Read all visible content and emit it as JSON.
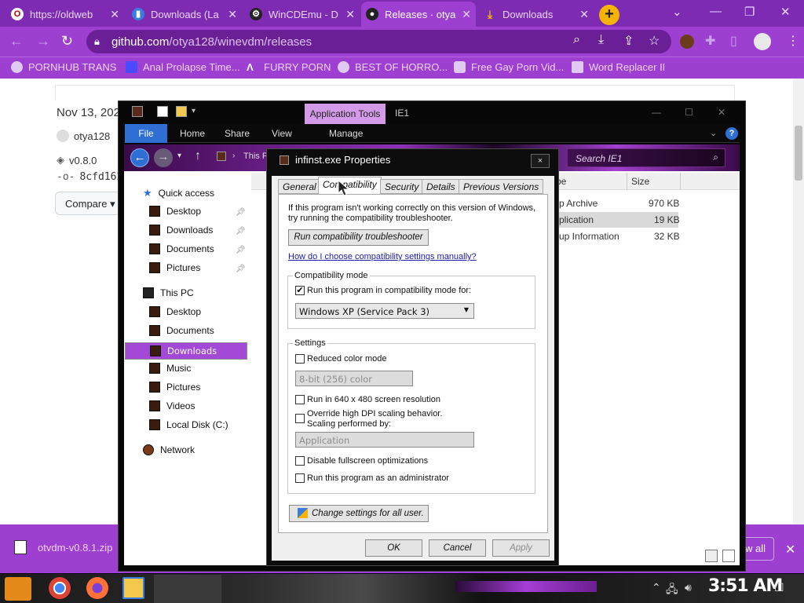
{
  "browser": {
    "tabs": [
      {
        "label": "https://oldweb",
        "icon": "opera-icon",
        "color": "#fff"
      },
      {
        "label": "Downloads (La",
        "icon": "doc-icon",
        "color": "#3b7ddd"
      },
      {
        "label": "WinCDEmu - D",
        "icon": "gear-icon",
        "color": "#222"
      },
      {
        "label": "Releases · otya",
        "icon": "github-icon",
        "color": "#222"
      },
      {
        "label": "Downloads",
        "icon": "download-icon",
        "color": "#f4b400"
      }
    ],
    "new_tab": "+",
    "url_domain": "github.com",
    "url_path": "/otya128/winevdm/releases",
    "bookmarks": [
      "PORNHUB TRANS",
      "Anal Prolapse Time...",
      "FURRY PORN",
      "BEST OF HORRO...",
      "Free Gay Porn Vid...",
      "Word Replacer II"
    ]
  },
  "github": {
    "date": "Nov 13, 202",
    "author": "otya128",
    "tag": "v0.8.0",
    "commit": "8cfd162",
    "compare": "Compare"
  },
  "shelf": {
    "filename": "otvdm-v0.8.1.zip",
    "show_all": "w all"
  },
  "explorer": {
    "app_tools": "Application Tools",
    "window_title": "IE1",
    "ribbon_tabs": [
      "File",
      "Home",
      "Share",
      "View",
      "Manage"
    ],
    "breadcrumb": "This P",
    "search_placeholder": "Search IE1",
    "nav": {
      "quick_access": "Quick access",
      "qa_items": [
        "Desktop",
        "Downloads",
        "Documents",
        "Pictures"
      ],
      "this_pc": "This PC",
      "pc_items": [
        "Desktop",
        "Documents",
        "Downloads",
        "Music",
        "Pictures",
        "Videos",
        "Local Disk (C:)"
      ],
      "network": "Network",
      "selected": "Downloads"
    },
    "columns": [
      "pe",
      "Size"
    ],
    "rows": [
      {
        "type": "p Archive",
        "size": "970 KB"
      },
      {
        "type": "plication",
        "size": "19 KB"
      },
      {
        "type": "up Information",
        "size": "32 KB"
      }
    ]
  },
  "dialog": {
    "title": "infinst.exe Properties",
    "close": "×",
    "tabs": [
      "General",
      "Compatibility",
      "Security",
      "Details",
      "Previous Versions"
    ],
    "active_tab": "Compatibility",
    "intro_line1": "If this program isn't working correctly on this version of Windows,",
    "intro_line2": "try running the compatibility troubleshooter.",
    "troubleshooter_button": "Run compatibility troubleshooter",
    "manual_link": "How do I choose compatibility settings manually?",
    "compat_group": "Compatibility mode",
    "compat_checkbox": "Run this program in compatibility mode for:",
    "compat_checked": true,
    "compat_select": "Windows XP (Service Pack 3)",
    "settings_group": "Settings",
    "reduced_color": "Reduced color mode",
    "color_select": "8-bit (256) color",
    "res_640": "Run in 640 x 480 screen resolution",
    "dpi_line1": "Override high DPI scaling behavior.",
    "dpi_line2": "Scaling performed by:",
    "dpi_select": "Application",
    "fullscreen": "Disable fullscreen optimizations",
    "admin": "Run this program as an administrator",
    "change_all": "Change settings for all user.",
    "ok": "OK",
    "cancel": "Cancel",
    "apply": "Apply"
  },
  "taskbar": {
    "clock": "3:51 AM"
  }
}
